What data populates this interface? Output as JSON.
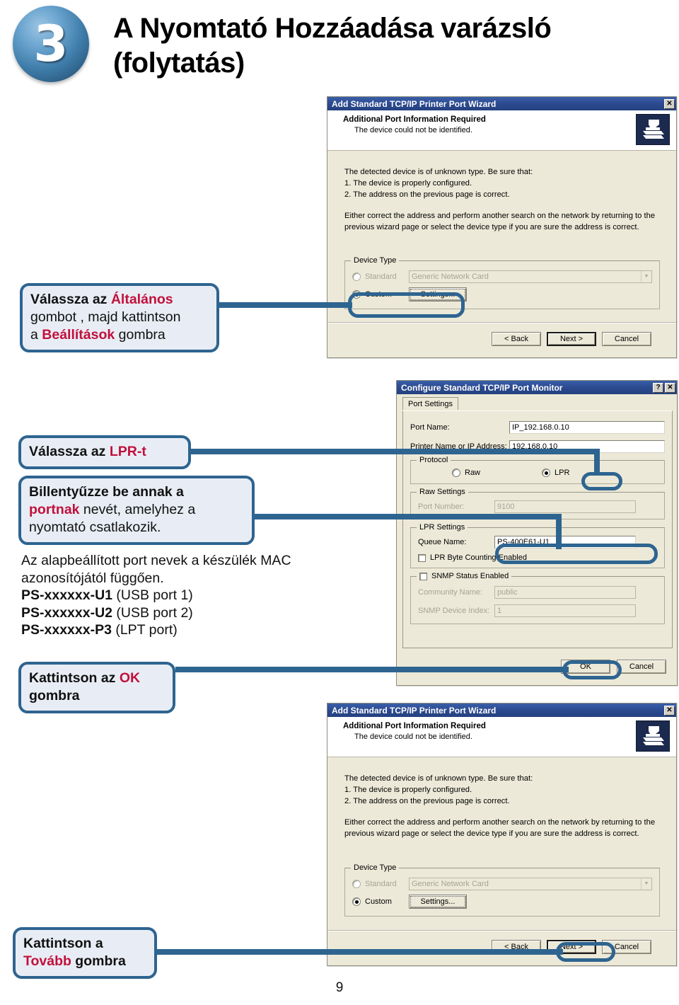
{
  "header": {
    "step_number": "3",
    "title_line1": "A Nyomtató Hozzáadása varázsló",
    "title_line2": "(folytatás)"
  },
  "page_number": "9",
  "dialog_wizard_top": {
    "title": "Add Standard TCP/IP Printer Port Wizard",
    "close_label": "✕",
    "heading": "Additional Port Information Required",
    "subheading": "The device could not be identified.",
    "body_line1": "The detected device is of unknown type.  Be sure that:",
    "body_line2": "1. The device is properly configured.",
    "body_line3": "2.  The address on the previous page is correct.",
    "body_para2_line1": "Either correct the address and perform another search on the network by returning to the",
    "body_para2_line2": "previous wizard page or select the device type if you are sure the address is correct.",
    "group_device_type": "Device Type",
    "radio_standard": "Standard",
    "combo_standard_value": "Generic Network Card",
    "radio_custom": "Custom",
    "btn_settings": "Settings...",
    "btn_back": "< Back",
    "btn_next": "Next >",
    "btn_cancel": "Cancel"
  },
  "dialog_port_monitor": {
    "title": "Configure Standard TCP/IP Port Monitor",
    "help_label": "?",
    "close_label": "✕",
    "tab_port_settings": "Port Settings",
    "label_port_name": "Port Name:",
    "value_port_name": "IP_192.168.0.10",
    "label_printer_name": "Printer Name or IP Address:",
    "value_printer_name": "192.168.0.10",
    "group_protocol": "Protocol",
    "radio_raw": "Raw",
    "radio_lpr": "LPR",
    "group_raw_settings": "Raw Settings",
    "label_port_number": "Port Number:",
    "value_port_number": "9100",
    "group_lpr_settings": "LPR Settings",
    "label_queue_name": "Queue Name:",
    "value_queue_name": "PS-400E61-U1",
    "check_lpr_byte_counting": "LPR Byte Counting Enabled",
    "check_snmp_status": "SNMP Status Enabled",
    "label_community_name": "Community Name:",
    "value_community_name": "public",
    "label_snmp_device_index": "SNMP Device Index:",
    "value_snmp_device_index": "1",
    "btn_ok": "OK",
    "btn_cancel": "Cancel"
  },
  "dialog_wizard_bottom": {
    "title": "Add Standard TCP/IP Printer Port Wizard",
    "close_label": "✕",
    "heading": "Additional Port Information Required",
    "subheading": "The device could not be identified.",
    "body_line1": "The detected device is of unknown type.  Be sure that:",
    "body_line2": "1. The device is properly configured.",
    "body_line3": "2.  The address on the previous page is correct.",
    "body_para2_line1": "Either correct the address and perform another search on the network by returning to the",
    "body_para2_line2": "previous wizard page or select the device type if you are sure the address is correct.",
    "group_device_type": "Device Type",
    "radio_standard": "Standard",
    "combo_standard_value": "Generic Network Card",
    "radio_custom": "Custom",
    "btn_settings": "Settings...",
    "btn_back": "< Back",
    "btn_next": "Next >",
    "btn_cancel": "Cancel"
  },
  "callouts": {
    "custom_settings": {
      "seg1": "Válassza az ",
      "seg2_highlight": "Általános",
      "seg3": "gombot , majd kattintson",
      "seg4": "a ",
      "seg5_highlight": "Beállítások",
      "seg6": " gombra"
    },
    "lpr": {
      "seg1": "Válassza az ",
      "seg2_highlight": "LPR-t"
    },
    "queue_name": {
      "seg1": "Billentyűzze be annak a",
      "seg2_highlight": "portnak",
      "seg3": " nevét, amelyhez a",
      "seg4": "nyomtató csatlakozik."
    },
    "ok": {
      "seg1": "Kattintson az ",
      "seg2_highlight": "OK",
      "seg3": "gombra"
    },
    "next": {
      "seg1": "Kattintson a",
      "seg2_highlight": "Tovább",
      "seg3": " gombra"
    }
  },
  "note_block": {
    "line1": "Az alapbeállított port nevek a készülék MAC",
    "line2": "azonosítójától függően.",
    "line3_bold": "PS-xxxxxx-U1",
    "line3_rest": " (USB port 1)",
    "line4_bold": "PS-xxxxxx-U2",
    "line4_rest": " (USB port 2)",
    "line5_bold": "PS-xxxxxx-P3",
    "line5_rest": " (LPT port)"
  },
  "colors": {
    "accent_blue": "#2e6490",
    "highlight_red": "#c2103c",
    "callout_bg": "#e8edf5",
    "titlebar_blue": "#2c4a90",
    "dialog_bg": "#ece9d8"
  }
}
